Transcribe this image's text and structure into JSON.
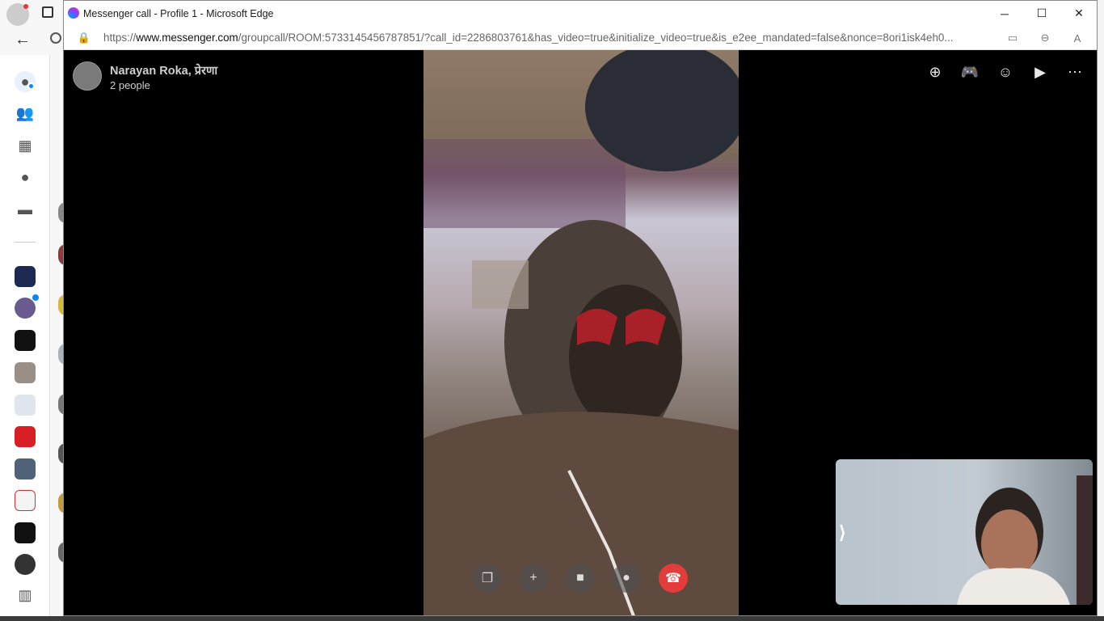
{
  "window": {
    "title": "Messenger call - Profile 1 - Microsoft Edge",
    "url_prefix": "https://",
    "url_host": "www.messenger.com",
    "url_rest": "/groupcall/ROOM:5733145456787851/?call_id=2286803761&has_video=true&initialize_video=true&is_e2ee_mandated=false&nonce=8ori1isk4eh0..."
  },
  "call": {
    "participants": "Narayan Roka, प्रेरणा",
    "count_label": "2 people",
    "chevron": "⟩"
  },
  "icons": {
    "window": [
      "minimize-icon",
      "maximize-icon",
      "close-icon"
    ],
    "address": [
      "lock-icon",
      "camera-icon",
      "zoom-icon",
      "read-aloud-icon"
    ],
    "top_actions": [
      "add-icon",
      "games-icon",
      "effects-icon",
      "share-screen-icon",
      "more-icon"
    ],
    "controls": [
      "screen-share-icon",
      "add-person-icon",
      "video-icon",
      "microphone-icon",
      "end-call-icon"
    ]
  },
  "colors": {
    "end_call": "#e43b3b",
    "stage": "#000000",
    "accent": "#0099ff"
  }
}
